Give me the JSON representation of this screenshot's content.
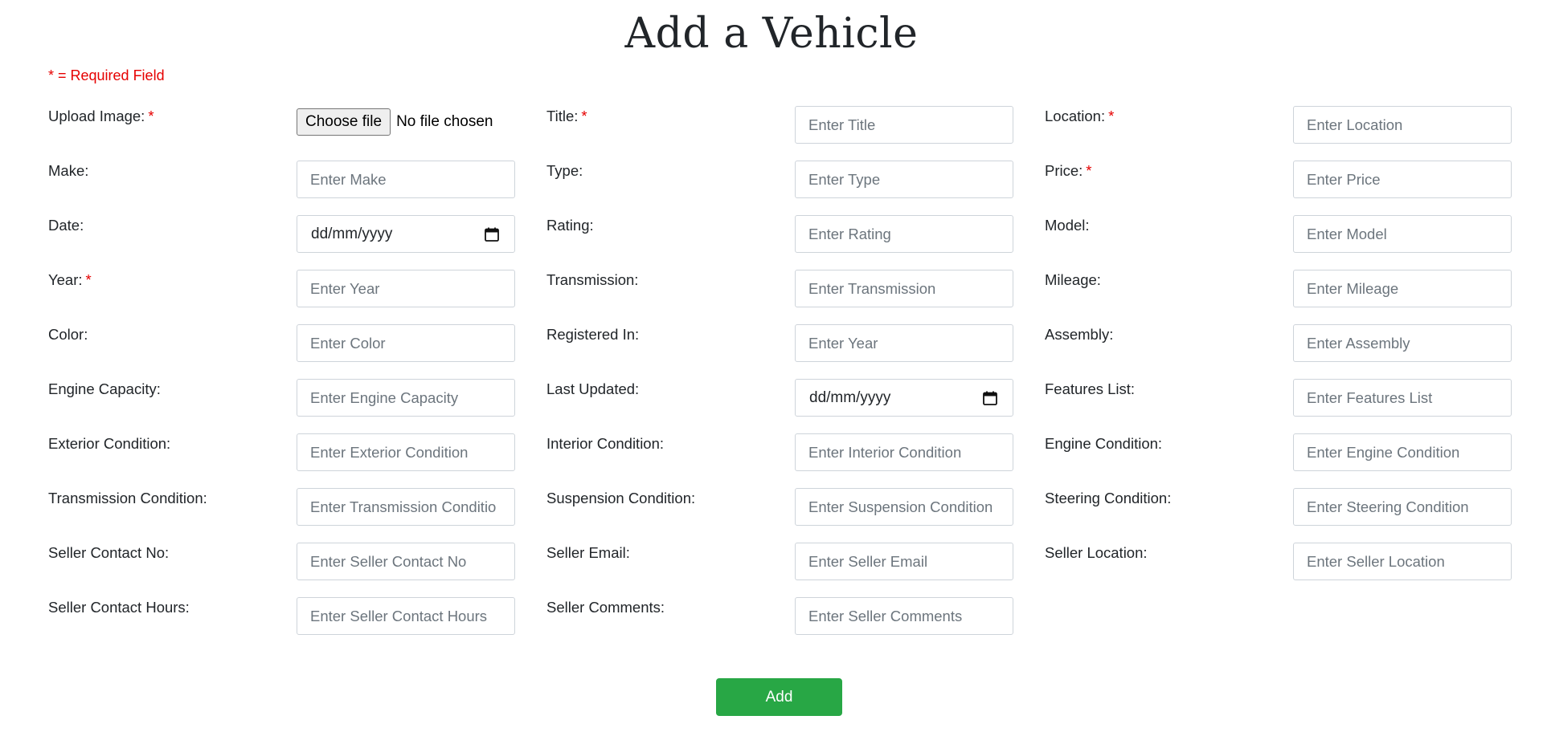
{
  "page": {
    "title": "Add a Vehicle",
    "required_note": "* = Required Field",
    "required_marker": "*",
    "submit_label": "Add"
  },
  "fields": [
    {
      "id": "upload-image",
      "label": "Upload Image:",
      "required": true,
      "type": "file",
      "button_label": "Choose file",
      "status": "No file chosen"
    },
    {
      "id": "title",
      "label": "Title:",
      "required": true,
      "type": "text",
      "placeholder": "Enter Title"
    },
    {
      "id": "location",
      "label": "Location:",
      "required": true,
      "type": "text",
      "placeholder": "Enter Location"
    },
    {
      "id": "make",
      "label": "Make:",
      "required": false,
      "type": "text",
      "placeholder": "Enter Make"
    },
    {
      "id": "type",
      "label": "Type:",
      "required": false,
      "type": "text",
      "placeholder": "Enter Type"
    },
    {
      "id": "price",
      "label": "Price:",
      "required": true,
      "type": "text",
      "placeholder": "Enter Price"
    },
    {
      "id": "date",
      "label": "Date:",
      "required": false,
      "type": "date",
      "placeholder": "dd/mm/yyyy",
      "icon": "calendar-icon"
    },
    {
      "id": "rating",
      "label": "Rating:",
      "required": false,
      "type": "text",
      "placeholder": "Enter Rating"
    },
    {
      "id": "model",
      "label": "Model:",
      "required": false,
      "type": "text",
      "placeholder": "Enter Model"
    },
    {
      "id": "year",
      "label": "Year:",
      "required": true,
      "type": "text",
      "placeholder": "Enter Year"
    },
    {
      "id": "transmission",
      "label": "Transmission:",
      "required": false,
      "type": "text",
      "placeholder": "Enter Transmission"
    },
    {
      "id": "mileage",
      "label": "Mileage:",
      "required": false,
      "type": "text",
      "placeholder": "Enter Mileage"
    },
    {
      "id": "color",
      "label": "Color:",
      "required": false,
      "type": "text",
      "placeholder": "Enter Color"
    },
    {
      "id": "registered-in",
      "label": "Registered In:",
      "required": false,
      "type": "text",
      "placeholder": "Enter Year"
    },
    {
      "id": "assembly",
      "label": "Assembly:",
      "required": false,
      "type": "text",
      "placeholder": "Enter Assembly"
    },
    {
      "id": "engine-capacity",
      "label": "Engine Capacity:",
      "required": false,
      "type": "text",
      "placeholder": "Enter Engine Capacity"
    },
    {
      "id": "last-updated",
      "label": "Last Updated:",
      "required": false,
      "type": "date",
      "placeholder": "dd/mm/yyyy",
      "icon": "calendar-icon"
    },
    {
      "id": "features-list",
      "label": "Features List:",
      "required": false,
      "type": "text",
      "placeholder": "Enter Features List"
    },
    {
      "id": "exterior-condition",
      "label": "Exterior Condition:",
      "required": false,
      "type": "text",
      "placeholder": "Enter Exterior Condition"
    },
    {
      "id": "interior-condition",
      "label": "Interior Condition:",
      "required": false,
      "type": "text",
      "placeholder": "Enter Interior Condition"
    },
    {
      "id": "engine-condition",
      "label": "Engine Condition:",
      "required": false,
      "type": "text",
      "placeholder": "Enter Engine Condition"
    },
    {
      "id": "transmission-condition",
      "label": "Transmission Condition:",
      "required": false,
      "type": "text",
      "placeholder": "Enter Transmission Conditio"
    },
    {
      "id": "suspension-condition",
      "label": "Suspension Condition:",
      "required": false,
      "type": "text",
      "placeholder": "Enter Suspension Condition"
    },
    {
      "id": "steering-condition",
      "label": "Steering Condition:",
      "required": false,
      "type": "text",
      "placeholder": "Enter Steering Condition"
    },
    {
      "id": "seller-contact-no",
      "label": "Seller Contact No:",
      "required": false,
      "type": "text",
      "placeholder": "Enter Seller Contact No"
    },
    {
      "id": "seller-email",
      "label": "Seller Email:",
      "required": false,
      "type": "text",
      "placeholder": "Enter Seller Email"
    },
    {
      "id": "seller-location",
      "label": "Seller Location:",
      "required": false,
      "type": "text",
      "placeholder": "Enter Seller Location"
    },
    {
      "id": "seller-contact-hours",
      "label": "Seller Contact Hours:",
      "required": false,
      "type": "text",
      "placeholder": "Enter Seller Contact Hours"
    },
    {
      "id": "seller-comments",
      "label": "Seller Comments:",
      "required": false,
      "type": "text",
      "placeholder": "Enter Seller Comments"
    }
  ],
  "colors": {
    "required": "#e60000",
    "submit": "#28a745",
    "input_border": "#ced4da",
    "placeholder": "#6c757d",
    "text": "#212529"
  }
}
